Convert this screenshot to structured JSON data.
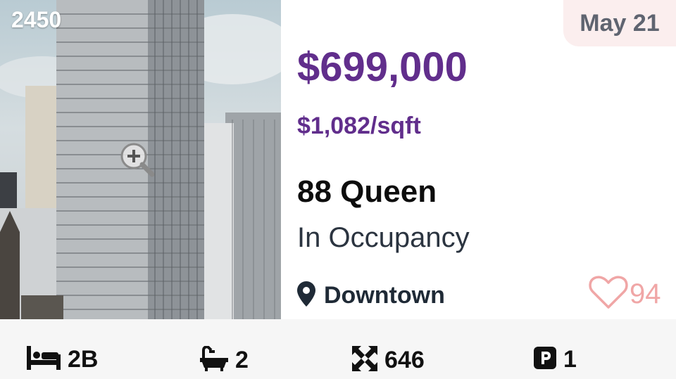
{
  "listing": {
    "photo_id": "2450",
    "listed_date": "May 21",
    "price": "$699,000",
    "price_per_sqft": "$1,082/sqft",
    "name": "88 Queen",
    "status": "In Occupancy",
    "location": "Downtown",
    "likes": "94"
  },
  "features": {
    "bedrooms": "2B",
    "bathrooms": "2",
    "size_sqft": "646",
    "parking": "1"
  },
  "icons": {
    "zoom": "zoom-in-icon",
    "location": "map-pin-icon",
    "like": "heart-outline-icon",
    "bedrooms": "bed-icon",
    "bathrooms": "bathtub-icon",
    "size": "expand-arrows-icon",
    "parking": "parking-icon"
  },
  "colors": {
    "price": "#612e8c",
    "date_badge_bg": "#fbeeee",
    "heart": "#f0a6a6"
  }
}
